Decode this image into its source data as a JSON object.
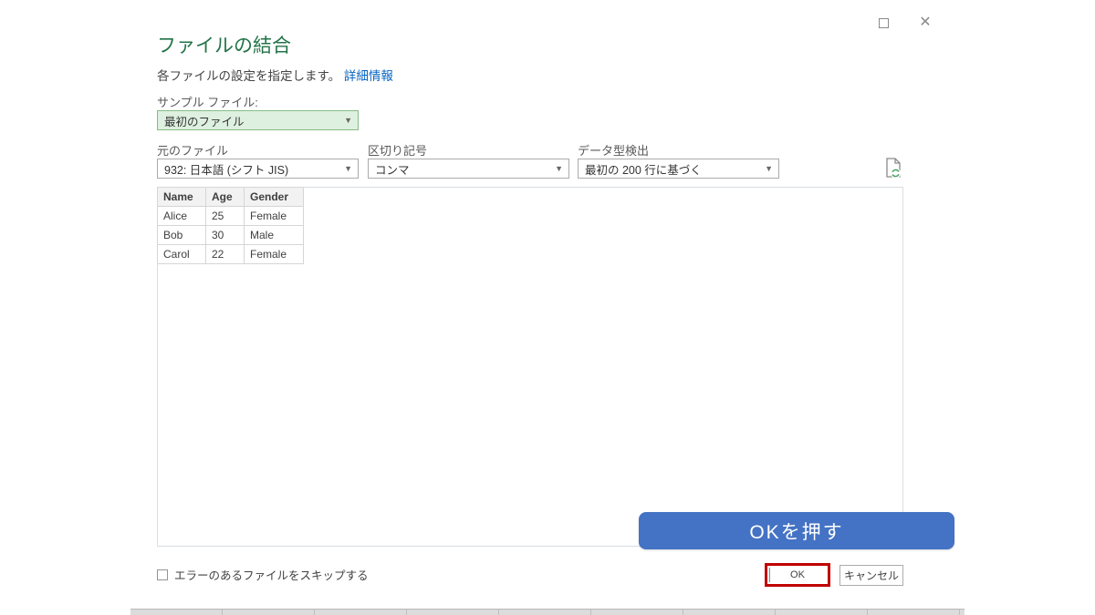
{
  "window": {
    "maximize_glyph": "",
    "close_glyph": "✕"
  },
  "dialog": {
    "title": "ファイルの結合",
    "subtitle": "各ファイルの設定を指定します。",
    "learn_more_label": "詳細情報",
    "sample_file": {
      "label": "サンプル ファイル:",
      "value": "最初のファイル"
    },
    "source_file": {
      "label": "元のファイル",
      "value": "932: 日本語 (シフト JIS)"
    },
    "delimiter": {
      "label": "区切り記号",
      "value": "コンマ"
    },
    "type_detection": {
      "label": "データ型検出",
      "value": "最初の 200 行に基づく"
    },
    "skip_errors_label": "エラーのあるファイルをスキップする",
    "ok_label": "OK",
    "cancel_label": "キャンセル",
    "chevron_glyph": "▼"
  },
  "preview_table": {
    "columns": [
      "Name",
      "Age",
      "Gender"
    ],
    "rows": [
      [
        "Alice",
        "25",
        "Female"
      ],
      [
        "Bob",
        "30",
        "Male"
      ],
      [
        "Carol",
        "22",
        "Female"
      ]
    ]
  },
  "tooltip": {
    "text": "OKを押す"
  },
  "colors": {
    "title_green": "#217346",
    "link_blue": "#0563c1",
    "sample_fill": "#def0e0",
    "sample_border": "#86bc86",
    "tooltip_blue": "#4472c4",
    "annotation_red": "#c00000"
  }
}
